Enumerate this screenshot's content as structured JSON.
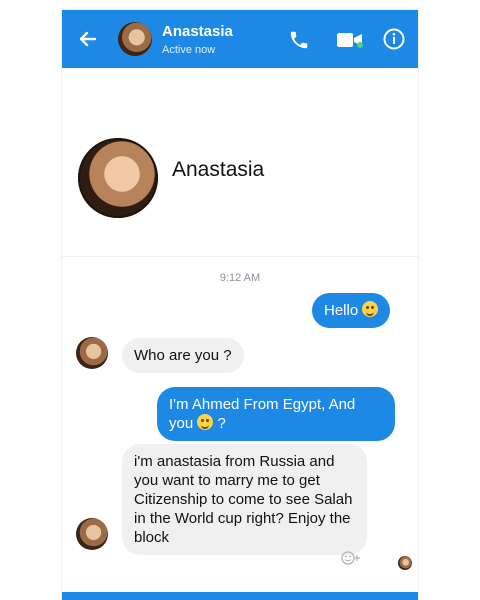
{
  "header": {
    "contact_name": "Anastasia",
    "status": "Active now",
    "icons": [
      "back-arrow-icon",
      "phone-icon",
      "video-camera-icon",
      "info-icon"
    ],
    "colors": {
      "bar": "#1e88e5",
      "text": "#ffffff"
    }
  },
  "profile": {
    "name": "Anastasia"
  },
  "conversation": {
    "timestamp": "9:12 AM",
    "messages": [
      {
        "from": "me",
        "text": "Hello",
        "emoji": "smile-emoji"
      },
      {
        "from": "them",
        "text": "Who are you ?"
      },
      {
        "from": "me",
        "text_line1": "I'm Ahmed From Egypt, And",
        "text_line2_pre": "you",
        "text_line2_post": " ?",
        "emoji": "laugh-emoji"
      },
      {
        "from": "them",
        "text": "i'm anastasia from Russia and you want to marry me to get Citizenship to come to see Salah in the World cup right? Enjoy the block"
      }
    ]
  }
}
